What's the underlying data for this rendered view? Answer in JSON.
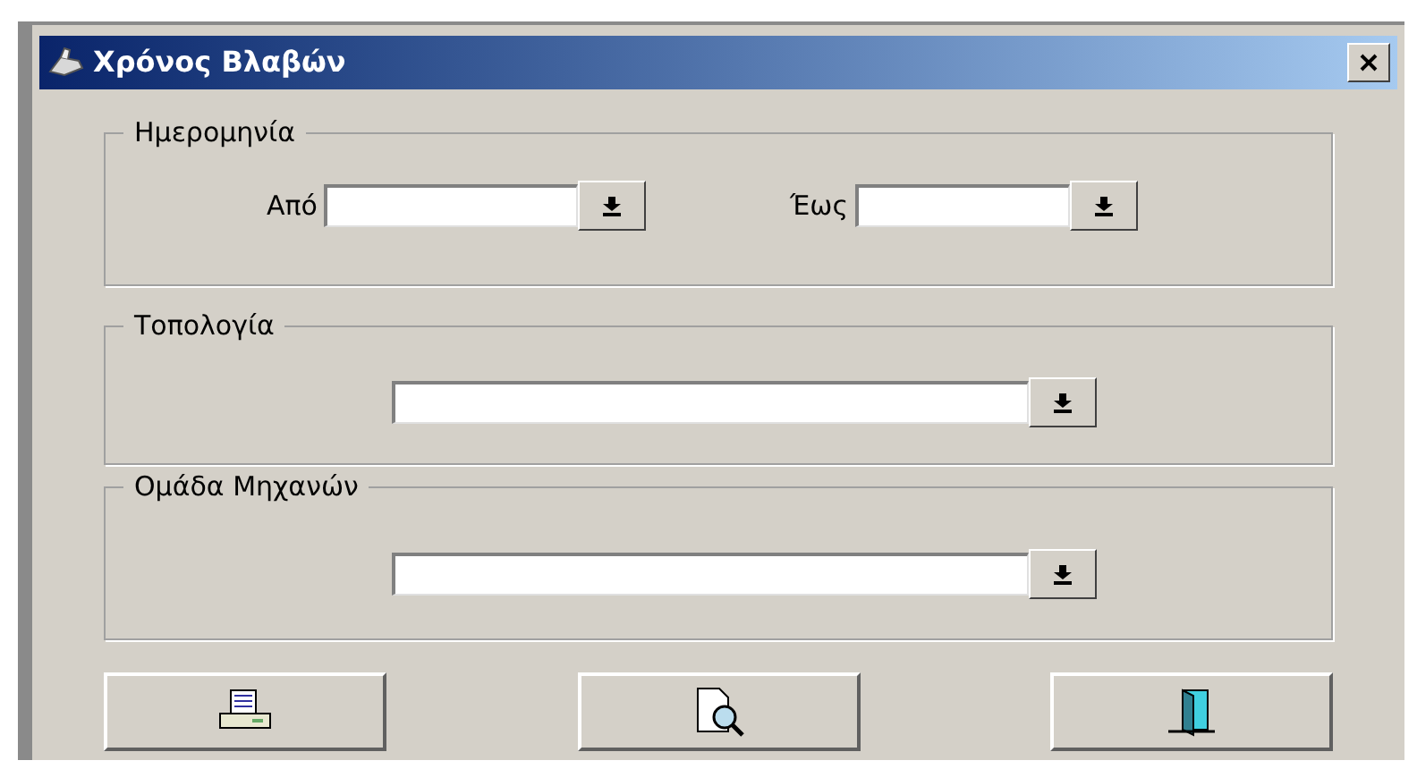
{
  "window": {
    "title": "Χρόνος Βλαβών"
  },
  "date_group": {
    "title": "Ημερομηνία",
    "from_label": "Από",
    "to_label": "Έως"
  },
  "topology_group": {
    "title": "Τοπολογία"
  },
  "machine_group": {
    "title": "Ομάδα Μηχανών"
  }
}
